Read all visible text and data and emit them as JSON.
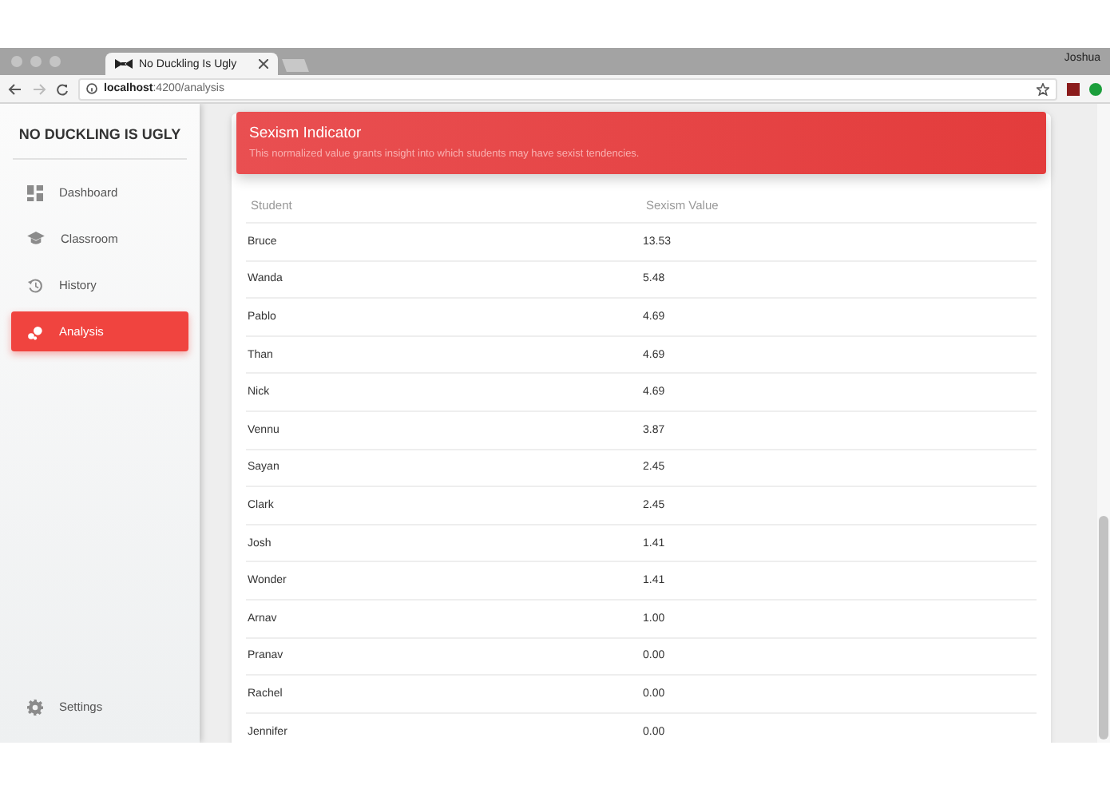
{
  "browser": {
    "tab_title": "No Duckling Is Ugly",
    "url_host": "localhost",
    "url_path": ":4200/analysis",
    "user": "Joshua"
  },
  "sidebar": {
    "title": "NO DUCKLING IS UGLY",
    "items": [
      {
        "label": "Dashboard",
        "kind": "dashboard",
        "selected": false
      },
      {
        "label": "Classroom",
        "kind": "classroom",
        "selected": false
      },
      {
        "label": "History",
        "kind": "history",
        "selected": false
      },
      {
        "label": "Analysis",
        "kind": "analysis",
        "selected": true
      }
    ],
    "footer": {
      "label": "Settings"
    }
  },
  "card": {
    "title": "Sexism Indicator",
    "subtitle": "This normalized value grants insight into which students may have sexist tendencies.",
    "table": {
      "columns": [
        "Student",
        "Sexism Value"
      ],
      "rows": [
        [
          "Bruce",
          "13.53"
        ],
        [
          "Wanda",
          "5.48"
        ],
        [
          "Pablo",
          "4.69"
        ],
        [
          "Than",
          "4.69"
        ],
        [
          "Nick",
          "4.69"
        ],
        [
          "Vennu",
          "3.87"
        ],
        [
          "Sayan",
          "2.45"
        ],
        [
          "Clark",
          "2.45"
        ],
        [
          "Josh",
          "1.41"
        ],
        [
          "Wonder",
          "1.41"
        ],
        [
          "Arnav",
          "1.00"
        ],
        [
          "Pranav",
          "0.00"
        ],
        [
          "Rachel",
          "0.00"
        ],
        [
          "Jennifer",
          "0.00"
        ]
      ]
    }
  }
}
